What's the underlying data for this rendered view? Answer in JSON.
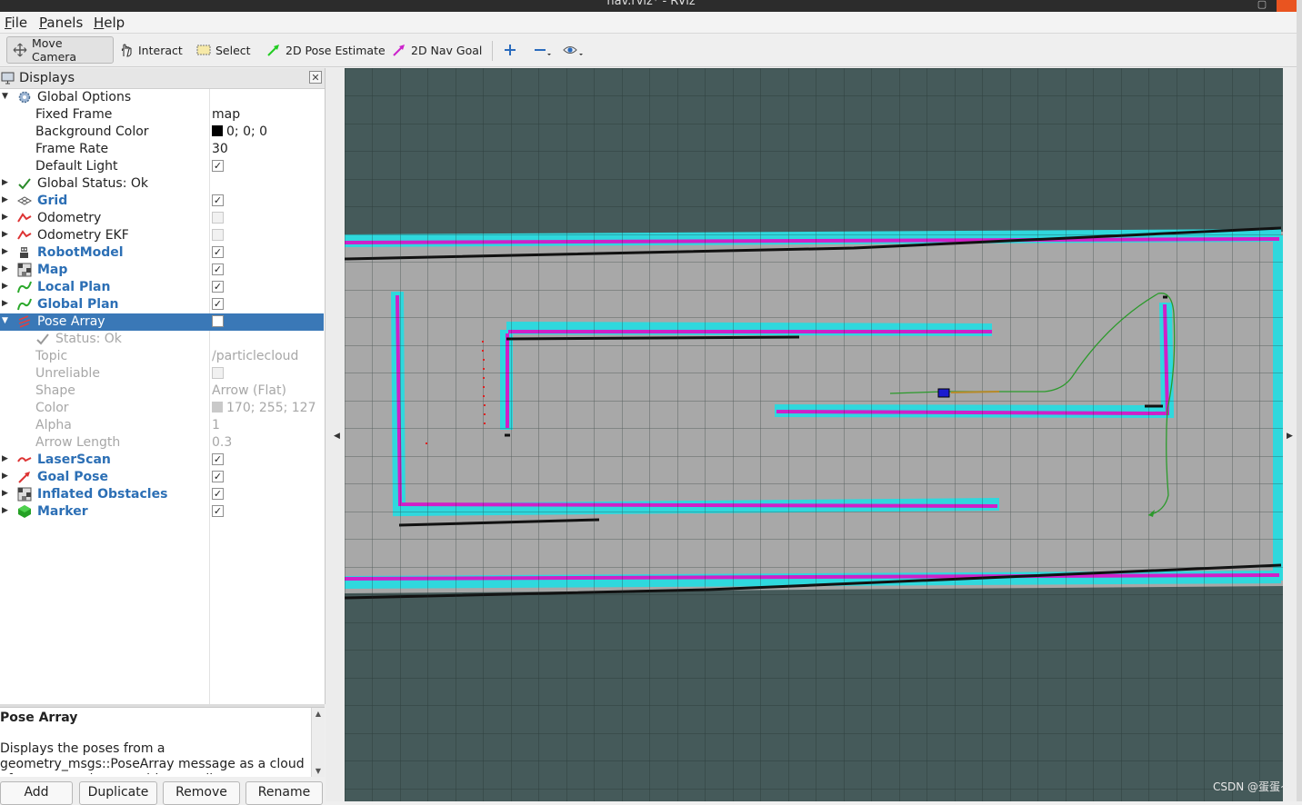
{
  "window": {
    "title": "nav.rviz* - RViz"
  },
  "menu": [
    {
      "label": "File",
      "mnemonic": "F",
      "rest": "ile"
    },
    {
      "label": "Panels",
      "mnemonic": "P",
      "rest": "anels"
    },
    {
      "label": "Help",
      "mnemonic": "H",
      "rest": "elp"
    }
  ],
  "toolbar": {
    "move_camera": "Move Camera",
    "interact": "Interact",
    "select": "Select",
    "pose_estimate": "2D Pose Estimate",
    "nav_goal": "2D Nav Goal",
    "active_tool": "Move Camera",
    "colors": {
      "pose_estimate": "#22cc22",
      "nav_goal": "#cc22cc",
      "zoom": "#2a6bbd"
    }
  },
  "displays": {
    "title": "Displays",
    "global_options": {
      "label": "Global Options",
      "fixed_frame_label": "Fixed Frame",
      "fixed_frame": "map",
      "bg_color_label": "Background Color",
      "bg_color": "0; 0; 0",
      "frame_rate_label": "Frame Rate",
      "frame_rate": "30",
      "default_light_label": "Default Light",
      "default_light": true
    },
    "global_status": "Global Status: Ok",
    "items": [
      {
        "name": "Grid",
        "enabled": true,
        "icon": "grid-icon"
      },
      {
        "name": "Odometry",
        "enabled": false,
        "icon": "odometry-icon"
      },
      {
        "name": "Odometry EKF",
        "enabled": false,
        "icon": "odometry-icon"
      },
      {
        "name": "RobotModel",
        "enabled": true,
        "icon": "robot-icon"
      },
      {
        "name": "Map",
        "enabled": true,
        "icon": "map-icon"
      },
      {
        "name": "Local Plan",
        "enabled": true,
        "icon": "path-icon"
      },
      {
        "name": "Global Plan",
        "enabled": true,
        "icon": "path-icon"
      }
    ],
    "pose_array": {
      "name": "Pose Array",
      "enabled": false,
      "status": "Status: Ok",
      "topic_label": "Topic",
      "topic": "/particlecloud",
      "unreliable_label": "Unreliable",
      "shape_label": "Shape",
      "shape": "Arrow (Flat)",
      "color_label": "Color",
      "color": "170; 255; 127",
      "alpha_label": "Alpha",
      "alpha": "1",
      "arrow_length_label": "Arrow Length",
      "arrow_length": "0.3"
    },
    "items_after": [
      {
        "name": "LaserScan",
        "enabled": true,
        "icon": "laserscan-icon"
      },
      {
        "name": "Goal Pose",
        "enabled": true,
        "icon": "goal-icon"
      },
      {
        "name": "Inflated Obstacles",
        "enabled": true,
        "icon": "map-icon"
      },
      {
        "name": "Marker",
        "enabled": true,
        "icon": "marker-icon"
      }
    ]
  },
  "description": {
    "title": "Pose Array",
    "text": "Displays the poses from a geometry_msgs::PoseArray message as a cloud of arrows, each pose with a small arrow."
  },
  "buttons": {
    "add": "Add",
    "duplicate": "Duplicate",
    "remove": "Remove",
    "rename": "Rename"
  },
  "watermark": "CSDN @蛋蛋~"
}
